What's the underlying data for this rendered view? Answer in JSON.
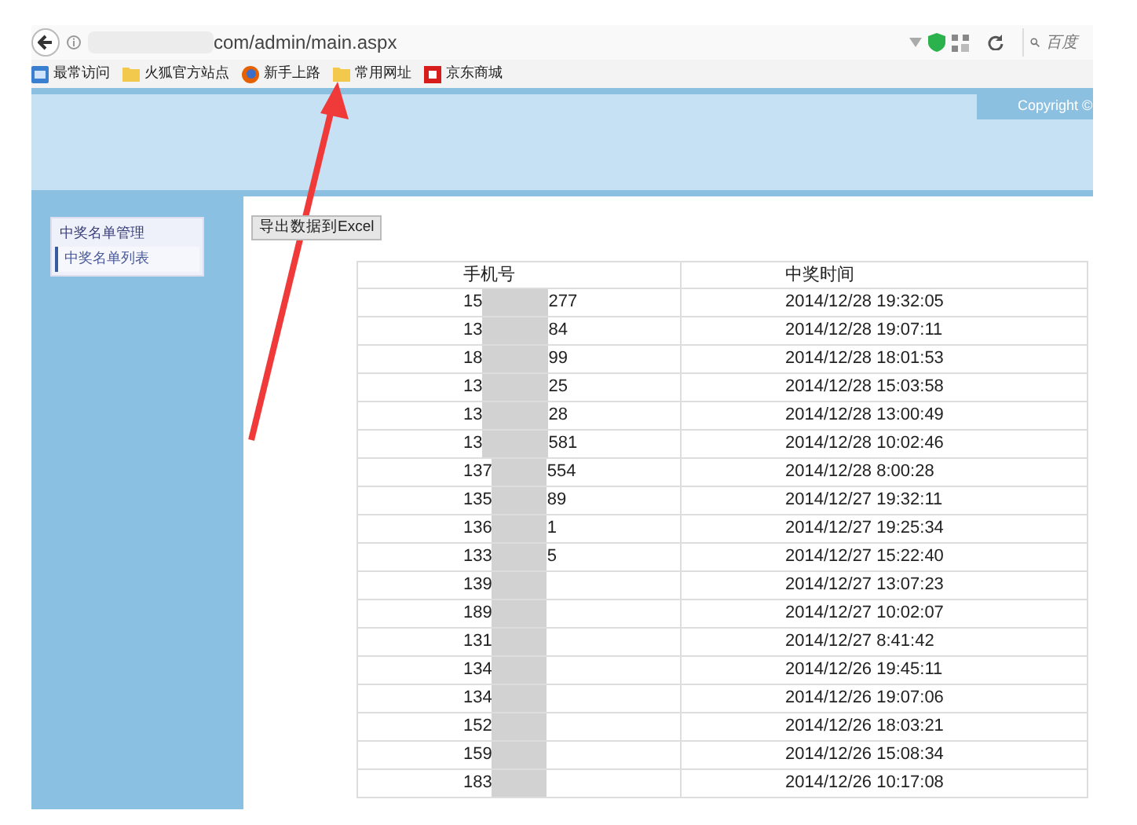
{
  "browser": {
    "url": "com/admin/main.aspx",
    "search_placeholder": "百度",
    "bookmarks": [
      {
        "kind": "page",
        "label": "最常访问"
      },
      {
        "kind": "folder",
        "label": "火狐官方站点"
      },
      {
        "kind": "firefox",
        "label": "新手上路"
      },
      {
        "kind": "folder",
        "label": "常用网址"
      },
      {
        "kind": "jd",
        "label": "京东商城"
      }
    ]
  },
  "header": {
    "copyright": "Copyright ©"
  },
  "sidebar": {
    "title": "中奖名单管理",
    "items": [
      {
        "label": "中奖名单列表",
        "selected": true
      }
    ]
  },
  "export_button": "导出数据到Excel",
  "table": {
    "columns": [
      "手机号",
      "中奖时间"
    ],
    "rows": [
      {
        "phone_start": "15",
        "phone_end": "277",
        "time": "2014/12/28 19:32:05"
      },
      {
        "phone_start": "13",
        "phone_end": "84",
        "time": "2014/12/28 19:07:11"
      },
      {
        "phone_start": "18",
        "phone_end": "99",
        "time": "2014/12/28 18:01:53"
      },
      {
        "phone_start": "13",
        "phone_end": "25",
        "time": "2014/12/28 15:03:58"
      },
      {
        "phone_start": "13",
        "phone_end": "28",
        "time": "2014/12/28 13:00:49"
      },
      {
        "phone_start": "13",
        "phone_end": "581",
        "time": "2014/12/28 10:02:46"
      },
      {
        "phone_start": "137",
        "phone_end": "554",
        "time": "2014/12/28 8:00:28"
      },
      {
        "phone_start": "135",
        "phone_end": "89",
        "time": "2014/12/27 19:32:11"
      },
      {
        "phone_start": "136",
        "phone_end": "1",
        "time": "2014/12/27 19:25:34"
      },
      {
        "phone_start": "133",
        "phone_end": "5",
        "time": "2014/12/27 15:22:40"
      },
      {
        "phone_start": "139",
        "time": "2014/12/27 13:07:23"
      },
      {
        "phone_start": "189",
        "time": "2014/12/27 10:02:07"
      },
      {
        "phone_start": "131",
        "time": "2014/12/27 8:41:42"
      },
      {
        "phone_start": "134",
        "time": "2014/12/26 19:45:11"
      },
      {
        "phone_start": "134",
        "time": "2014/12/26 19:07:06"
      },
      {
        "phone_start": "152",
        "time": "2014/12/26 18:03:21"
      },
      {
        "phone_start": "159",
        "time": "2014/12/26 15:08:34"
      },
      {
        "phone_start": "183",
        "time": "2014/12/26 10:17:08"
      }
    ]
  }
}
